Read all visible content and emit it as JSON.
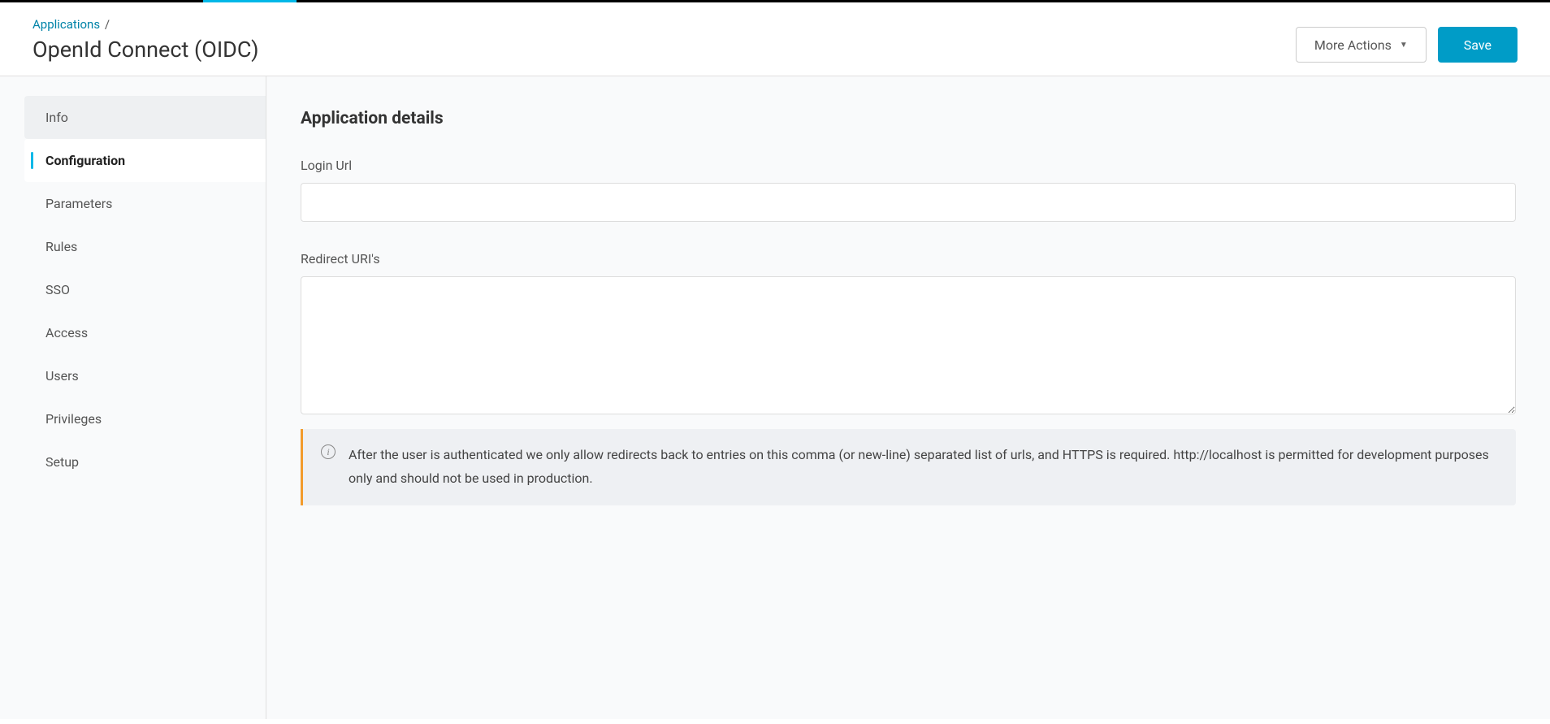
{
  "breadcrumb": {
    "parent": "Applications",
    "separator": "/"
  },
  "page_title": "OpenId Connect (OIDC)",
  "header_actions": {
    "more_actions_label": "More Actions",
    "save_label": "Save"
  },
  "sidebar": {
    "items": [
      {
        "label": "Info",
        "active": false
      },
      {
        "label": "Configuration",
        "active": true
      },
      {
        "label": "Parameters",
        "active": false
      },
      {
        "label": "Rules",
        "active": false
      },
      {
        "label": "SSO",
        "active": false
      },
      {
        "label": "Access",
        "active": false
      },
      {
        "label": "Users",
        "active": false
      },
      {
        "label": "Privileges",
        "active": false
      },
      {
        "label": "Setup",
        "active": false
      }
    ]
  },
  "content": {
    "section_title": "Application details",
    "login_url_label": "Login Url",
    "login_url_value": "",
    "redirect_uris_label": "Redirect URI's",
    "redirect_uris_value": "",
    "info_message": "After the user is authenticated we only allow redirects back to entries on this comma (or new-line) separated list of urls, and HTTPS is required. http://localhost is permitted for development purposes only and should not be used in production."
  }
}
